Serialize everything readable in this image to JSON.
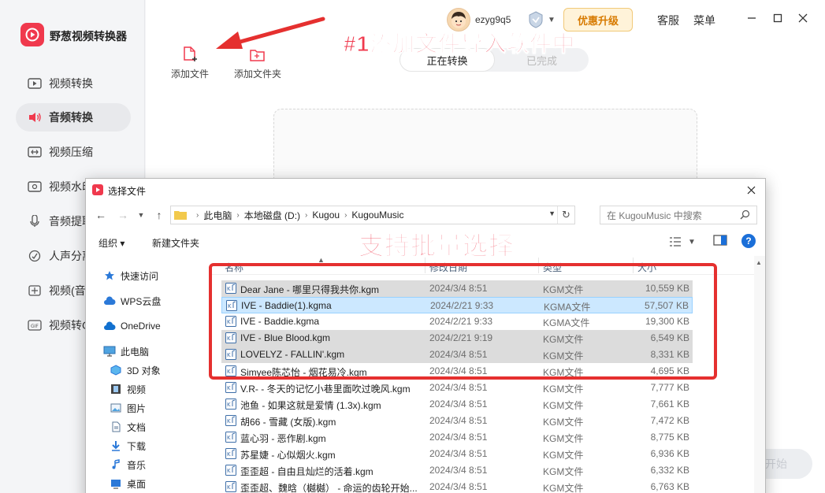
{
  "app": {
    "name": "野葱视频转换器",
    "username": "ezyg9q5",
    "upgrade_label": "优惠升级",
    "help_label": "客服",
    "menu_label": "菜单"
  },
  "sidebar": {
    "items": [
      {
        "label": "视频转换",
        "icon": "video-convert-icon"
      },
      {
        "label": "音频转换",
        "icon": "audio-convert-icon"
      },
      {
        "label": "视频压缩",
        "icon": "video-compress-icon"
      },
      {
        "label": "视频水印",
        "icon": "watermark-icon"
      },
      {
        "label": "音频提取",
        "icon": "audio-extract-icon"
      },
      {
        "label": "人声分离",
        "icon": "voice-separate-icon"
      },
      {
        "label": "视频(音",
        "icon": "video-audio-icon"
      },
      {
        "label": "视频转G",
        "icon": "gif-icon"
      }
    ]
  },
  "toolbar": {
    "add_file_label": "添加文件",
    "add_folder_label": "添加文件夹"
  },
  "tabs": {
    "converting": "正在转换",
    "done": "已完成"
  },
  "start_label": "开始",
  "annotations": {
    "step1": "#1添加文件导入软件中",
    "step2": "支持批量选择"
  },
  "dialog": {
    "title": "选择文件",
    "breadcrumb": [
      "此电脑",
      "本地磁盘 (D:)",
      "Kugou",
      "KugouMusic"
    ],
    "search_placeholder": "在 KugouMusic 中搜索",
    "organize_label": "组织 ▾",
    "new_folder_label": "新建文件夹",
    "help_glyph": "?",
    "nav": {
      "quick_access": "快速访问",
      "wps_cloud": "WPS云盘",
      "onedrive": "OneDrive",
      "this_pc": "此电脑",
      "objects_3d": "3D 对象",
      "videos": "视频",
      "pictures": "图片",
      "documents": "文档",
      "downloads": "下载",
      "music": "音乐",
      "desktop": "桌面"
    },
    "columns": {
      "name": "名称",
      "modified": "修改日期",
      "type": "类型",
      "size": "大小"
    },
    "files": [
      {
        "name": "Dear Jane - 哪里只得我共你.kgm",
        "date": "2024/3/4 8:51",
        "type": "KGM文件",
        "size": "10,559 KB",
        "state": "selected"
      },
      {
        "name": "IVE - Baddie(1).kgma",
        "date": "2024/2/21 9:33",
        "type": "KGMA文件",
        "size": "57,507 KB",
        "state": "focused"
      },
      {
        "name": "IVE - Baddie.kgma",
        "date": "2024/2/21 9:33",
        "type": "KGMA文件",
        "size": "19,300 KB",
        "state": "none"
      },
      {
        "name": "IVE - Blue Blood.kgm",
        "date": "2024/2/21 9:19",
        "type": "KGM文件",
        "size": "6,549 KB",
        "state": "selected"
      },
      {
        "name": "LOVELYZ - FALLIN'.kgm",
        "date": "2024/3/4 8:51",
        "type": "KGM文件",
        "size": "8,331 KB",
        "state": "selected"
      },
      {
        "name": "Simyee陈芯怡 - 烟花易冷.kgm",
        "date": "2024/3/4 8:51",
        "type": "KGM文件",
        "size": "4,695 KB",
        "state": "none"
      },
      {
        "name": "V.R- - 冬天的记忆小巷里面吹过晚风.kgm",
        "date": "2024/3/4 8:51",
        "type": "KGM文件",
        "size": "7,777 KB",
        "state": "none"
      },
      {
        "name": "池鱼 - 如果这就是爱情 (1.3x).kgm",
        "date": "2024/3/4 8:51",
        "type": "KGM文件",
        "size": "7,661 KB",
        "state": "none"
      },
      {
        "name": "胡66 - 雪藏 (女版).kgm",
        "date": "2024/3/4 8:51",
        "type": "KGM文件",
        "size": "7,472 KB",
        "state": "none"
      },
      {
        "name": "蓝心羽 - 恶作剧.kgm",
        "date": "2024/3/4 8:51",
        "type": "KGM文件",
        "size": "8,775 KB",
        "state": "none"
      },
      {
        "name": "苏星婕 - 心似烟火.kgm",
        "date": "2024/3/4 8:51",
        "type": "KGM文件",
        "size": "6,936 KB",
        "state": "none"
      },
      {
        "name": "歪歪超 - 自由且灿烂的活着.kgm",
        "date": "2024/3/4 8:51",
        "type": "KGM文件",
        "size": "6,332 KB",
        "state": "none"
      },
      {
        "name": "歪歪超、魏晗（樾樾） - 命运的齿轮开始...",
        "date": "2024/3/4 8:51",
        "type": "KGM文件",
        "size": "6,763 KB",
        "state": "none"
      }
    ]
  },
  "colors": {
    "brand_red": "#f0394d",
    "annotation_box": "#e5302f",
    "upgrade_text": "#d77a00",
    "selection": "#cce8ff"
  }
}
